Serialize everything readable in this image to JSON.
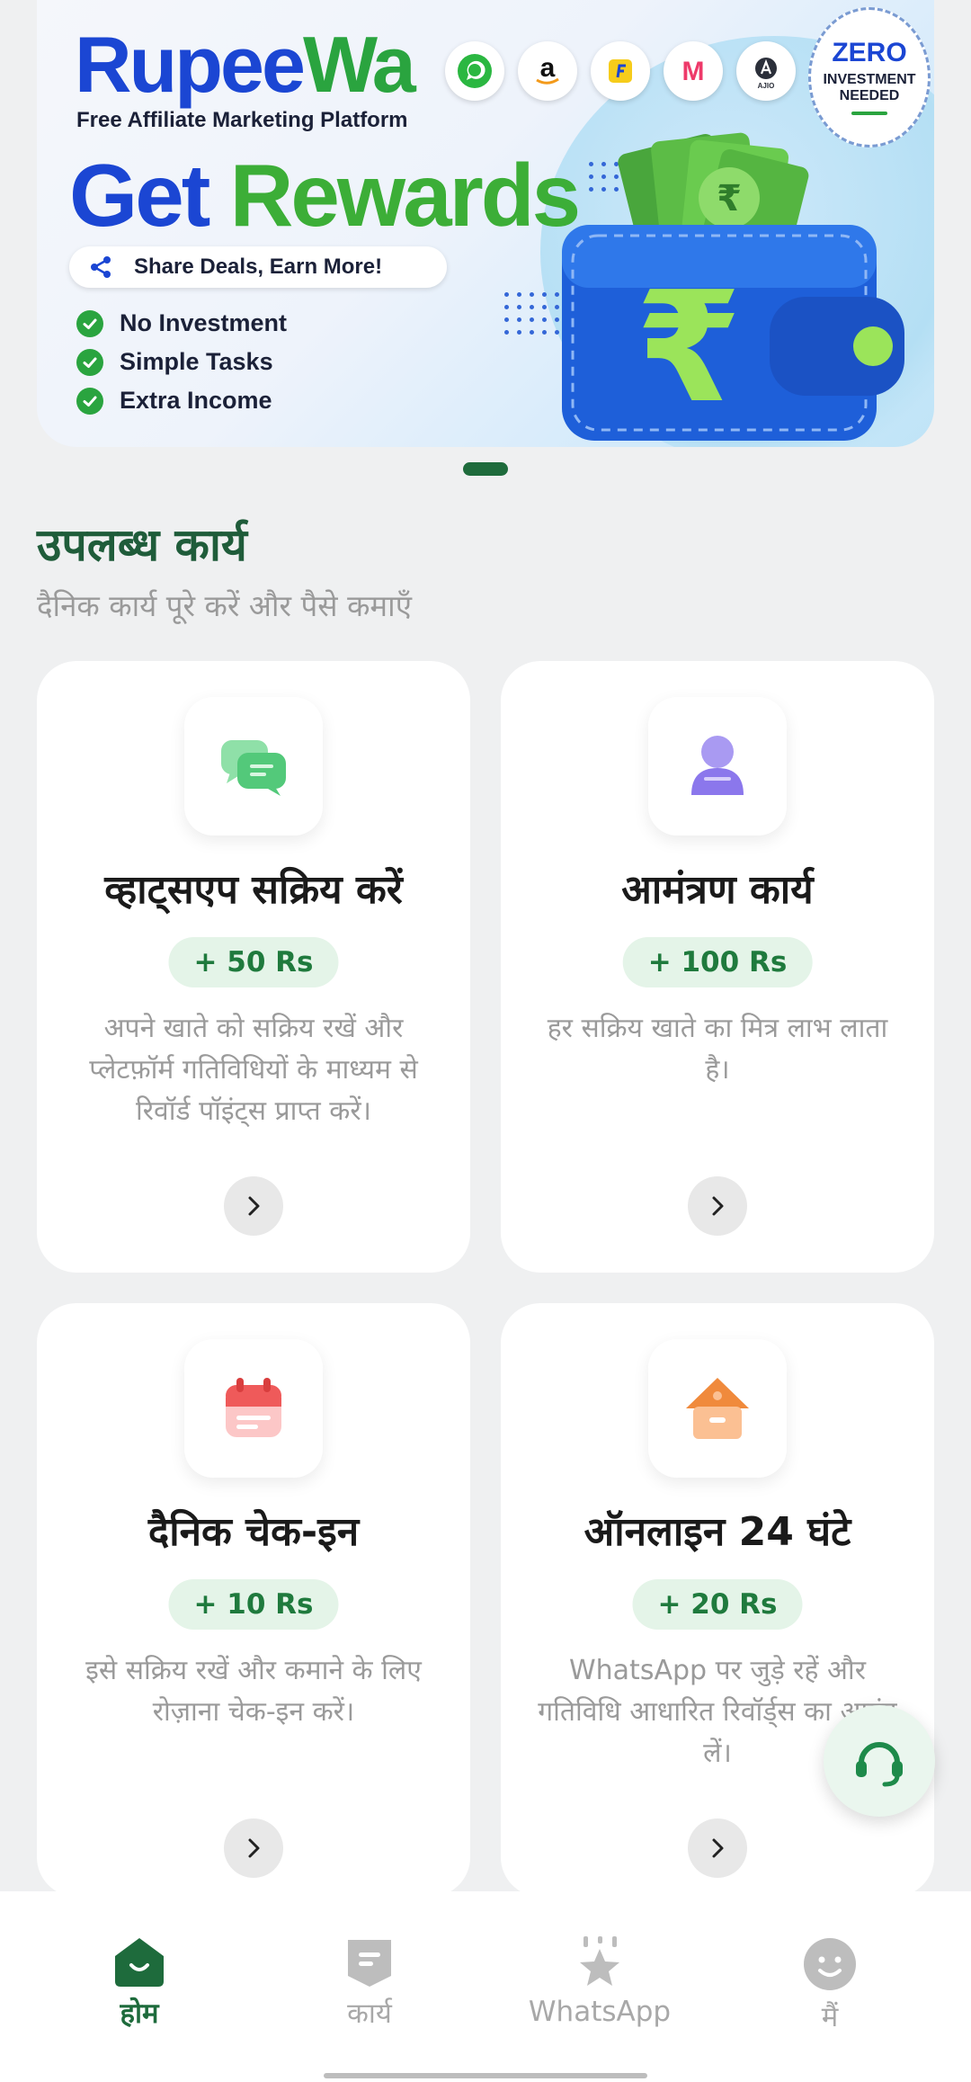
{
  "banner": {
    "brand_part1": "Rupee",
    "brand_part2": "Wa",
    "tagline": "Free Affiliate Marketing Platform",
    "headline_part1": "Get",
    "headline_part2": "Rewards",
    "share_text": "Share Deals, Earn More!",
    "bullets": [
      "No Investment",
      "Simple Tasks",
      "Extra Income"
    ],
    "badge_line1": "ZERO",
    "badge_line2": "INVESTMENT",
    "badge_line3": "NEEDED",
    "partner_logos": [
      "whatsapp-logo",
      "amazon-logo",
      "flipkart-logo",
      "myntra-logo",
      "ajio-logo"
    ],
    "ajio_text": "AJIO",
    "amazon_letter": "a",
    "myntra_letter": "M",
    "currency_symbol": "₹"
  },
  "carousel": {
    "pages": 1,
    "active": 1
  },
  "section": {
    "title": "उपलब्ध कार्य",
    "subtitle": "दैनिक कार्य पूरे करें और पैसे कमाएँ"
  },
  "tasks": [
    {
      "icon": "chat-bubbles-icon",
      "title": "व्हाट्सएप सक्रिय करें",
      "reward": "+ 50 Rs",
      "description": "अपने खाते को सक्रिय रखें और प्लेटफ़ॉर्म गतिविधियों के माध्यम से रिवॉर्ड पॉइंट्स प्राप्त करें।"
    },
    {
      "icon": "user-icon",
      "title": "आमंत्रण कार्य",
      "reward": "+ 100 Rs",
      "description": "हर सक्रिय खाते का मित्र लाभ लाता है।"
    },
    {
      "icon": "calendar-icon",
      "title": "दैनिक चेक-इन",
      "reward": "+ 10 Rs",
      "description": "इसे सक्रिय रखें और कमाने के लिए रोज़ाना चेक-इन करें।"
    },
    {
      "icon": "house-icon",
      "title": "ऑनलाइन 24 घंटे",
      "reward": "+ 20 Rs",
      "description": "WhatsApp पर जुड़े रहें और गतिविधि आधारित रिवॉर्ड्स का आनंद लें।"
    }
  ],
  "nav": {
    "items": [
      {
        "label": "होम",
        "icon": "home-icon",
        "active": true
      },
      {
        "label": "कार्य",
        "icon": "task-icon",
        "active": false
      },
      {
        "label": "WhatsApp",
        "icon": "whatsapp-star-icon",
        "active": false
      },
      {
        "label": "मैं",
        "icon": "smiley-icon",
        "active": false
      }
    ]
  },
  "colors": {
    "brand_blue": "#1b46d3",
    "brand_green": "#2aa43f",
    "section_green": "#1f5c3a",
    "reward_bg": "#e4f4e8",
    "reward_text": "#1f7a3d",
    "nav_active": "#1e6b3c",
    "nav_inactive": "#a8a8a8"
  }
}
